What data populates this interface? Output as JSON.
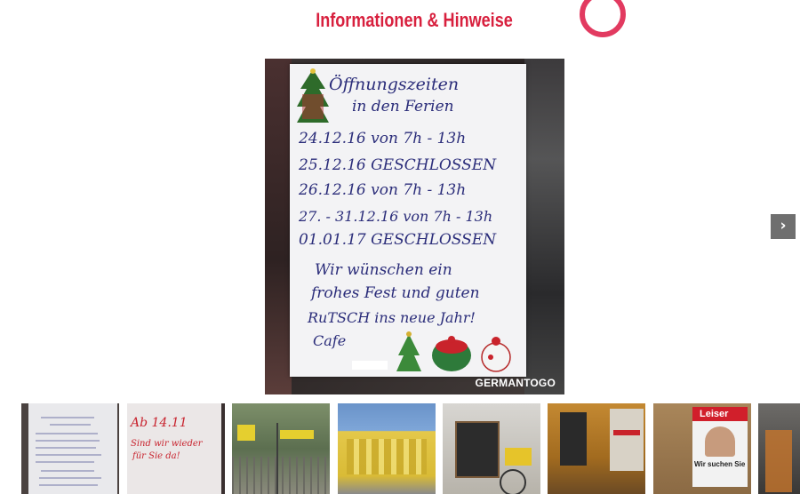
{
  "header": {
    "title": "Informationen & Hinweise"
  },
  "main_photo": {
    "sign_lines": [
      "Öffnungszeiten",
      "in den Ferien",
      "24.12.16 von 7h - 13h",
      "25.12.16 GESCHLOSSEN",
      "26.12.16 von 7h - 13h",
      "27. - 31.12.16 von 7h - 13h",
      "01.01.17 GESCHLOSSEN",
      "Wir wünschen ein",
      "frohes Fest und guten",
      "RuTSCH ins neue Jahr!",
      "Cafe"
    ],
    "watermark": "GERMANTOGO"
  },
  "carousel": {
    "next_icon": "chevron-right-icon",
    "next_label": "›"
  },
  "thumbnails": [
    {
      "name": "thumb-holiday-sign",
      "text": ""
    },
    {
      "name": "thumb-ab-1411",
      "text_1": "Ab 14.11",
      "text_2": "Sind wir wieder",
      "text_3": "für Sie da!"
    },
    {
      "name": "thumb-gate",
      "text": ""
    },
    {
      "name": "thumb-yellow-building",
      "text": ""
    },
    {
      "name": "thumb-chalkboard-bike",
      "text": ""
    },
    {
      "name": "thumb-cafe-window",
      "text": ""
    },
    {
      "name": "thumb-leiser-poster",
      "title": "Leiser",
      "subtitle": "Wir suchen Sie"
    },
    {
      "name": "thumb-shop-entrance",
      "text": ""
    }
  ]
}
